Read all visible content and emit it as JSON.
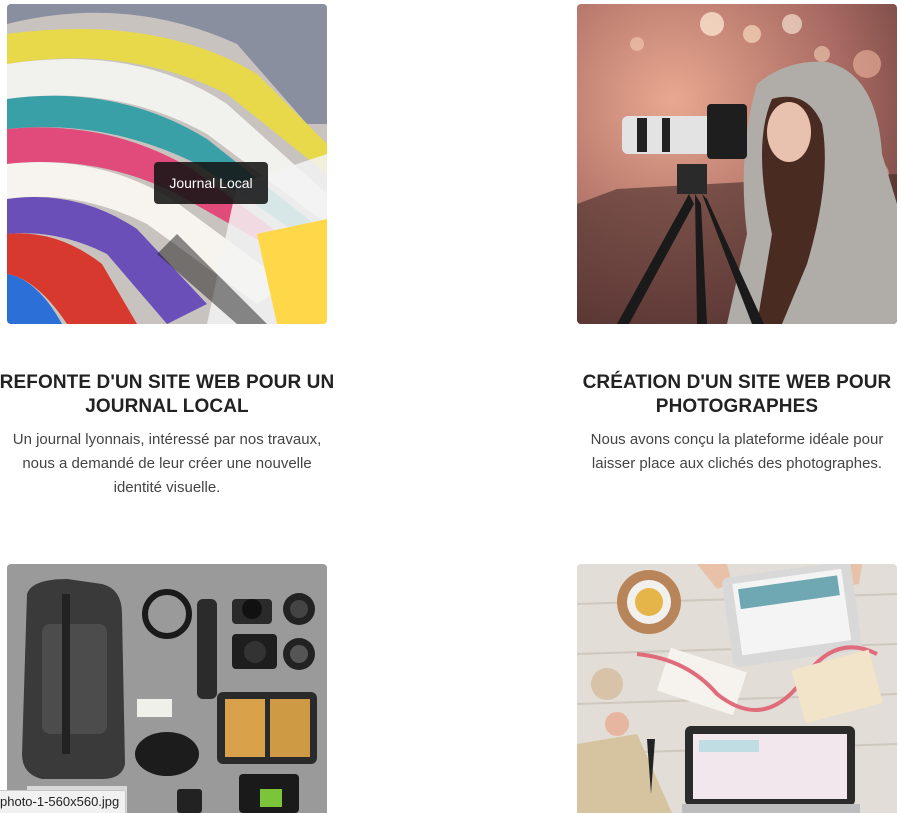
{
  "projects": [
    {
      "title": "REFONTE D'UN SITE WEB POUR UN JOURNAL LOCAL",
      "description": "Un journal lyonnais, intéressé par nos travaux, nous a demandé de leur créer une nouvelle identité visuelle.",
      "tooltip": "Journal Local"
    },
    {
      "title": "CRÉATION D'UN SITE WEB POUR PHOTOGRAPHES",
      "description": "Nous avons conçu la plateforme idéale pour laisser place aux clichés des photographes."
    }
  ],
  "status_bar": {
    "url": "photo-1-560x560.jpg"
  }
}
